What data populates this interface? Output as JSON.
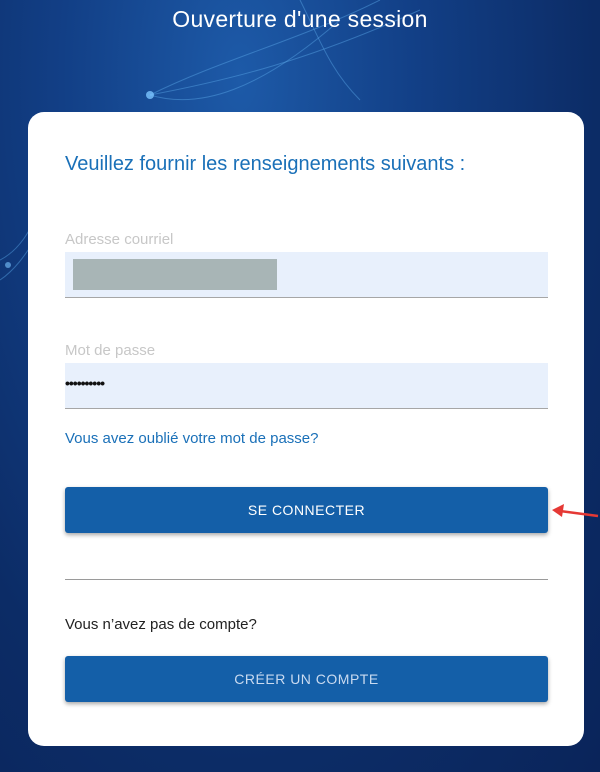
{
  "header": {
    "title": "Ouverture d'une session"
  },
  "form": {
    "subtitle": "Veuillez fournir les renseignements suivants :",
    "email": {
      "label": "Adresse courriel",
      "value": ""
    },
    "password": {
      "label": "Mot de passe",
      "value": "••••••••••"
    },
    "forgot_link": "Vous avez oublié votre mot de passe?",
    "connect_button": "SE CONNECTER",
    "no_account_text": "Vous n’avez pas de compte?",
    "create_button": "CRÉER UN COMPTE"
  },
  "colors": {
    "background": "#123f86",
    "accent": "#1a70b8",
    "button": "#145fa8",
    "field_bg": "#e8f0fc",
    "annotation_arrow": "#e53935"
  }
}
